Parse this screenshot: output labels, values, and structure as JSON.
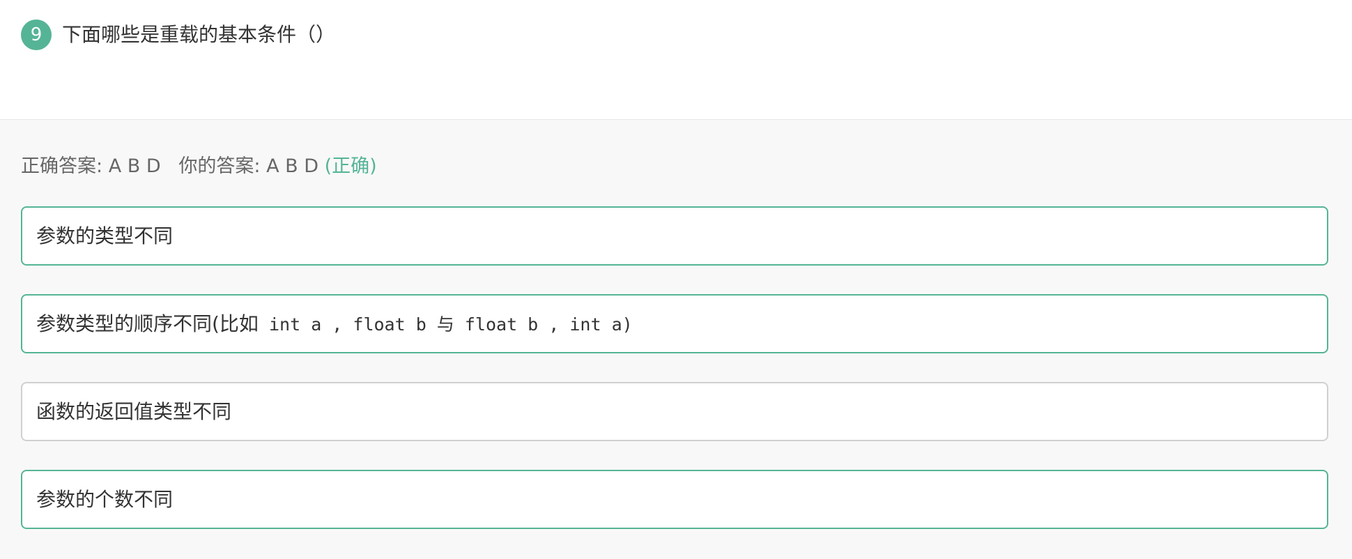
{
  "question": {
    "number": "9",
    "text": "下面哪些是重载的基本条件（）"
  },
  "answer": {
    "correct_label": "正确答案: ",
    "correct_value": "A B D",
    "yours_label": "你的答案: ",
    "yours_value": "A B D",
    "status": "(正确)"
  },
  "options": [
    {
      "text": "参数的类型不同",
      "state": "selected"
    },
    {
      "text_prefix": "参数类型的顺序不同(比如",
      "text_code": " int a , float b 与 float b , int a)",
      "state": "selected"
    },
    {
      "text": "函数的返回值类型不同",
      "state": "unselected"
    },
    {
      "text": "参数的个数不同",
      "state": "selected"
    }
  ],
  "colors": {
    "accent": "#55b496",
    "border_unselected": "#d0d0d0",
    "answer_area_bg": "#f8f8f8"
  }
}
